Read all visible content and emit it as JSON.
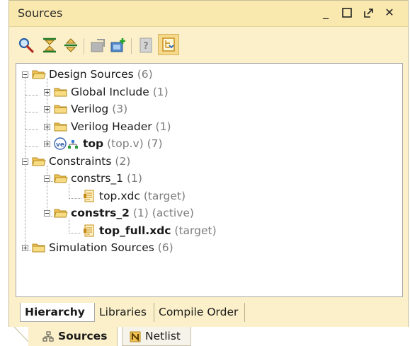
{
  "window": {
    "title": "Sources",
    "minimize": "_",
    "maximize": "☐",
    "restore": "⇱",
    "close": "✕"
  },
  "toolbar": {
    "icons": [
      "search-icon",
      "collapse-all-icon",
      "expand-all-icon",
      "settings-icon",
      "add-sources-icon",
      "properties-icon",
      "show-hierarchy-icon"
    ]
  },
  "tree": {
    "design_sources": {
      "label": "Design Sources",
      "count": "(6)"
    },
    "global_include": {
      "label": "Global Include",
      "count": "(1)"
    },
    "verilog": {
      "label": "Verilog",
      "count": "(3)"
    },
    "verilog_header": {
      "label": "Verilog Header",
      "count": "(1)"
    },
    "top": {
      "label": "top",
      "file": "(top.v)",
      "count": "(7)"
    },
    "constraints": {
      "label": "Constraints",
      "count": "(2)"
    },
    "constrs_1": {
      "label": "constrs_1",
      "count": "(1)"
    },
    "top_xdc": {
      "label": "top.xdc",
      "tag": "(target)"
    },
    "constrs_2": {
      "label": "constrs_2",
      "count": "(1)",
      "tag": "(active)"
    },
    "top_full_xdc": {
      "label": "top_full.xdc",
      "tag": "(target)"
    },
    "simulation_sources": {
      "label": "Simulation Sources",
      "count": "(6)"
    }
  },
  "bottom_tabs": {
    "hierarchy": "Hierarchy",
    "libraries": "Libraries",
    "compile_order": "Compile Order"
  },
  "outer_tabs": {
    "sources": "Sources",
    "netlist": "Netlist"
  },
  "colors": {
    "panel_bg": "#fbf0c9",
    "title_bg": "#fae9ae",
    "folder": "#f0c253",
    "accent": "#f6d98a"
  }
}
